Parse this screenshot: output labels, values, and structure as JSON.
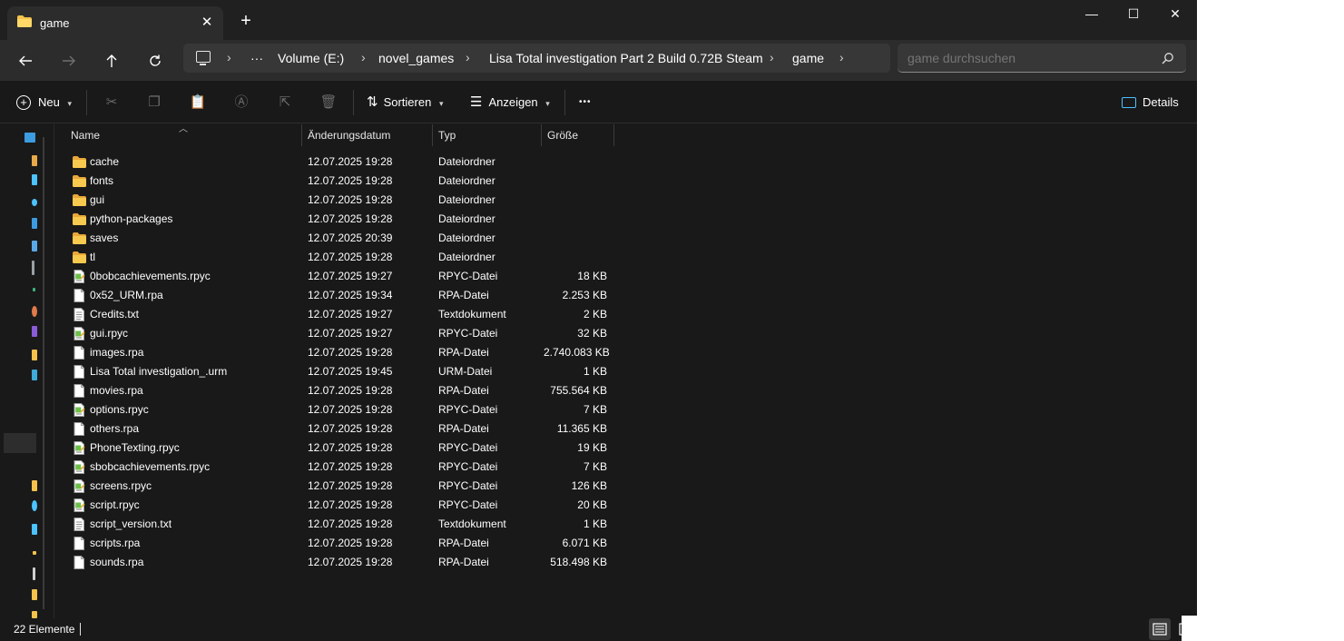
{
  "window": {
    "tab_title": "game",
    "new_tab_symbol": "+",
    "close_symbol": "✕",
    "minimize_symbol": "—",
    "maximize_symbol": "☐",
    "window_close_symbol": "✕"
  },
  "address": {
    "ellipsis": "···",
    "crumbs": [
      "Volume (E:)",
      "novel_games",
      "Lisa Total investigation Part 2 Build 0.72B Steam",
      "game"
    ],
    "chevron": "›"
  },
  "search": {
    "placeholder": "game durchsuchen"
  },
  "commandbar": {
    "new_label": "Neu",
    "sort_label": "Sortieren",
    "view_label": "Anzeigen",
    "more_label": "•••",
    "details_label": "Details"
  },
  "columns": {
    "name": "Name",
    "date": "Änderungsdatum",
    "type": "Typ",
    "size": "Größe"
  },
  "files": [
    {
      "name": "cache",
      "date": "12.07.2025 19:28",
      "type": "Dateiordner",
      "size": "",
      "icon": "folder-icon"
    },
    {
      "name": "fonts",
      "date": "12.07.2025 19:28",
      "type": "Dateiordner",
      "size": "",
      "icon": "folder-icon"
    },
    {
      "name": "gui",
      "date": "12.07.2025 19:28",
      "type": "Dateiordner",
      "size": "",
      "icon": "folder-icon"
    },
    {
      "name": "python-packages",
      "date": "12.07.2025 19:28",
      "type": "Dateiordner",
      "size": "",
      "icon": "folder-icon"
    },
    {
      "name": "saves",
      "date": "12.07.2025 20:39",
      "type": "Dateiordner",
      "size": "",
      "icon": "folder-icon"
    },
    {
      "name": "tl",
      "date": "12.07.2025 19:28",
      "type": "Dateiordner",
      "size": "",
      "icon": "folder-icon"
    },
    {
      "name": "0bobcachievements.rpyc",
      "date": "12.07.2025 19:27",
      "type": "RPYC-Datei",
      "size": "18 KB",
      "icon": "rpyc-file-icon"
    },
    {
      "name": "0x52_URM.rpa",
      "date": "12.07.2025 19:34",
      "type": "RPA-Datei",
      "size": "2.253 KB",
      "icon": "file-icon"
    },
    {
      "name": "Credits.txt",
      "date": "12.07.2025 19:27",
      "type": "Textdokument",
      "size": "2 KB",
      "icon": "text-file-icon"
    },
    {
      "name": "gui.rpyc",
      "date": "12.07.2025 19:27",
      "type": "RPYC-Datei",
      "size": "32 KB",
      "icon": "rpyc-file-icon"
    },
    {
      "name": "images.rpa",
      "date": "12.07.2025 19:28",
      "type": "RPA-Datei",
      "size": "2.740.083 KB",
      "icon": "file-icon"
    },
    {
      "name": "Lisa Total investigation_.urm",
      "date": "12.07.2025 19:45",
      "type": "URM-Datei",
      "size": "1 KB",
      "icon": "file-icon"
    },
    {
      "name": "movies.rpa",
      "date": "12.07.2025 19:28",
      "type": "RPA-Datei",
      "size": "755.564 KB",
      "icon": "file-icon"
    },
    {
      "name": "options.rpyc",
      "date": "12.07.2025 19:28",
      "type": "RPYC-Datei",
      "size": "7 KB",
      "icon": "rpyc-file-icon"
    },
    {
      "name": "others.rpa",
      "date": "12.07.2025 19:28",
      "type": "RPA-Datei",
      "size": "11.365 KB",
      "icon": "file-icon"
    },
    {
      "name": "PhoneTexting.rpyc",
      "date": "12.07.2025 19:28",
      "type": "RPYC-Datei",
      "size": "19 KB",
      "icon": "rpyc-file-icon"
    },
    {
      "name": "sbobcachievements.rpyc",
      "date": "12.07.2025 19:28",
      "type": "RPYC-Datei",
      "size": "7 KB",
      "icon": "rpyc-file-icon"
    },
    {
      "name": "screens.rpyc",
      "date": "12.07.2025 19:28",
      "type": "RPYC-Datei",
      "size": "126 KB",
      "icon": "rpyc-file-icon"
    },
    {
      "name": "script.rpyc",
      "date": "12.07.2025 19:28",
      "type": "RPYC-Datei",
      "size": "20 KB",
      "icon": "rpyc-file-icon"
    },
    {
      "name": "script_version.txt",
      "date": "12.07.2025 19:28",
      "type": "Textdokument",
      "size": "1 KB",
      "icon": "text-file-icon"
    },
    {
      "name": "scripts.rpa",
      "date": "12.07.2025 19:28",
      "type": "RPA-Datei",
      "size": "6.071 KB",
      "icon": "file-icon"
    },
    {
      "name": "sounds.rpa",
      "date": "12.07.2025 19:28",
      "type": "RPA-Datei",
      "size": "518.498 KB",
      "icon": "file-icon"
    }
  ],
  "status": {
    "item_count": "22 Elemente"
  },
  "colors": {
    "background": "#191919",
    "folder": "#f5c24c",
    "accent": "#4cc2ff"
  }
}
